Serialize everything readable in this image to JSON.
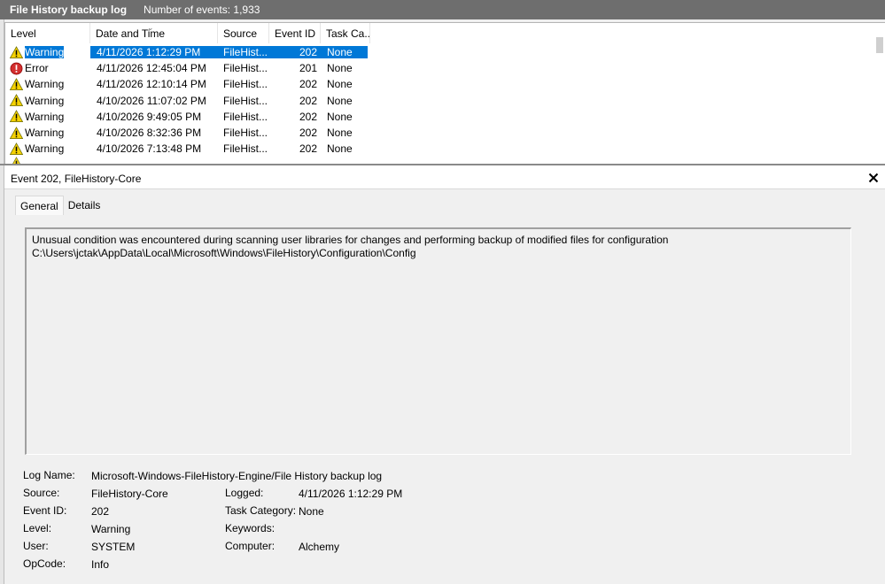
{
  "title_bar": {
    "log_name": "File History backup log",
    "event_count": "Number of events: 1,933"
  },
  "columns": [
    "Level",
    "Date and Time",
    "Source",
    "Event ID",
    "Task Ca..."
  ],
  "events": [
    {
      "level": "Warning",
      "date": "4/11/2026 1:12:29 PM",
      "source": "FileHist...",
      "event_id": "202",
      "task": "None",
      "icon": "warning-icon",
      "selected": true
    },
    {
      "level": "Error",
      "date": "4/11/2026 12:45:04 PM",
      "source": "FileHist...",
      "event_id": "201",
      "task": "None",
      "icon": "error-icon"
    },
    {
      "level": "Warning",
      "date": "4/11/2026 12:10:14 PM",
      "source": "FileHist...",
      "event_id": "202",
      "task": "None",
      "icon": "warning-icon"
    },
    {
      "level": "Warning",
      "date": "4/10/2026 11:07:02 PM",
      "source": "FileHist...",
      "event_id": "202",
      "task": "None",
      "icon": "warning-icon"
    },
    {
      "level": "Warning",
      "date": "4/10/2026 9:49:05 PM",
      "source": "FileHist...",
      "event_id": "202",
      "task": "None",
      "icon": "warning-icon"
    },
    {
      "level": "Warning",
      "date": "4/10/2026 8:32:36 PM",
      "source": "FileHist...",
      "event_id": "202",
      "task": "None",
      "icon": "warning-icon"
    },
    {
      "level": "Warning",
      "date": "4/10/2026 7:13:48 PM",
      "source": "FileHist...",
      "event_id": "202",
      "task": "None",
      "icon": "warning-icon"
    }
  ],
  "detail": {
    "header": "Event 202, FileHistory-Core",
    "tabs": [
      "General",
      "Details"
    ],
    "message": "Unusual condition was encountered during scanning user libraries for changes and performing backup of modified files for configuration C:\\Users\\jctak\\AppData\\Local\\Microsoft\\Windows\\FileHistory\\Configuration\\Config",
    "labels": {
      "log_name": "Log Name:",
      "source": "Source:",
      "event_id": "Event ID:",
      "level": "Level:",
      "user": "User:",
      "opcode": "OpCode:",
      "logged": "Logged:",
      "task_category": "Task Category:",
      "keywords": "Keywords:",
      "computer": "Computer:"
    },
    "values": {
      "log_name": "Microsoft-Windows-FileHistory-Engine/File History backup log",
      "source": "FileHistory-Core",
      "event_id": "202",
      "level": "Warning",
      "user": "SYSTEM",
      "opcode": "Info",
      "logged": "4/11/2026 1:12:29 PM",
      "task_category": "None",
      "keywords": "",
      "computer": "Alchemy"
    }
  },
  "colors": {
    "selection": "#0078d7",
    "title_bar": "#6e6e6e",
    "warning": "#f5d200",
    "error": "#d32f2f"
  }
}
